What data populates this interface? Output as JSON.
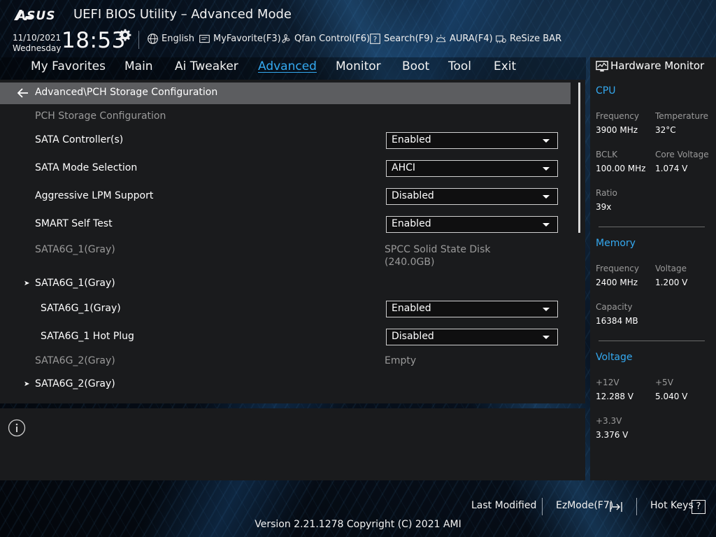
{
  "header": {
    "brand": "ASUS",
    "title": "UEFI BIOS Utility – Advanced Mode",
    "date": "11/10/2021",
    "weekday": "Wednesday",
    "time": "18:53",
    "utilities": [
      {
        "label": "English",
        "icon": "globe-icon"
      },
      {
        "label": "MyFavorite(F3)",
        "icon": "favorite-icon"
      },
      {
        "label": "Qfan Control(F6)",
        "icon": "fan-icon"
      },
      {
        "label": "Search(F9)",
        "icon": "search-icon"
      },
      {
        "label": "AURA(F4)",
        "icon": "aura-icon"
      },
      {
        "label": "ReSize BAR",
        "icon": "resize-bar-icon"
      }
    ]
  },
  "tabs": [
    {
      "label": "My Favorites",
      "active": false
    },
    {
      "label": "Main",
      "active": false
    },
    {
      "label": "Ai Tweaker",
      "active": false
    },
    {
      "label": "Advanced",
      "active": true
    },
    {
      "label": "Monitor",
      "active": false
    },
    {
      "label": "Boot",
      "active": false
    },
    {
      "label": "Tool",
      "active": false
    },
    {
      "label": "Exit",
      "active": false
    }
  ],
  "breadcrumb": "Advanced\\PCH Storage Configuration",
  "settings": {
    "section_title": "PCH Storage Configuration",
    "sata_controllers": {
      "label": "SATA Controller(s)",
      "value": "Enabled"
    },
    "sata_mode": {
      "label": "SATA Mode Selection",
      "value": "AHCI"
    },
    "lpm": {
      "label": "Aggressive LPM Support",
      "value": "Disabled"
    },
    "smart": {
      "label": "SMART Self Test",
      "value": "Enabled"
    },
    "port1_info": {
      "label": "SATA6G_1(Gray)",
      "value_line1": "SPCC Solid State Disk",
      "value_line2": "(240.0GB)"
    },
    "port1_group": {
      "label": "SATA6G_1(Gray)"
    },
    "port1_enable": {
      "label": "SATA6G_1(Gray)",
      "value": "Enabled"
    },
    "port1_hotplug": {
      "label": "SATA6G_1 Hot Plug",
      "value": "Disabled"
    },
    "port2_info": {
      "label": "SATA6G_2(Gray)",
      "value": "Empty"
    },
    "port2_group": {
      "label": "SATA6G_2(Gray)"
    }
  },
  "hardware_monitor": {
    "title": "Hardware Monitor",
    "cpu": {
      "heading": "CPU",
      "frequency_label": "Frequency",
      "frequency": "3900 MHz",
      "temperature_label": "Temperature",
      "temperature": "32°C",
      "bclk_label": "BCLK",
      "bclk": "100.00 MHz",
      "core_voltage_label": "Core Voltage",
      "core_voltage": "1.074 V",
      "ratio_label": "Ratio",
      "ratio": "39x"
    },
    "memory": {
      "heading": "Memory",
      "frequency_label": "Frequency",
      "frequency": "2400 MHz",
      "voltage_label": "Voltage",
      "voltage": "1.200 V",
      "capacity_label": "Capacity",
      "capacity": "16384 MB"
    },
    "voltage": {
      "heading": "Voltage",
      "v12_label": "+12V",
      "v12": "12.288 V",
      "v5_label": "+5V",
      "v5": "5.040 V",
      "v33_label": "+3.3V",
      "v33": "3.376 V"
    }
  },
  "footer": {
    "last_modified": "Last Modified",
    "ezmode": "EzMode(F7)",
    "hotkeys": "Hot Keys",
    "hotkeys_key": "?",
    "version": "Version 2.21.1278 Copyright (C) 2021 AMI"
  },
  "colors": {
    "accent": "#34a9f0",
    "panel": "#1a1b1d",
    "breadcrumb_bar": "#5c5d60"
  }
}
